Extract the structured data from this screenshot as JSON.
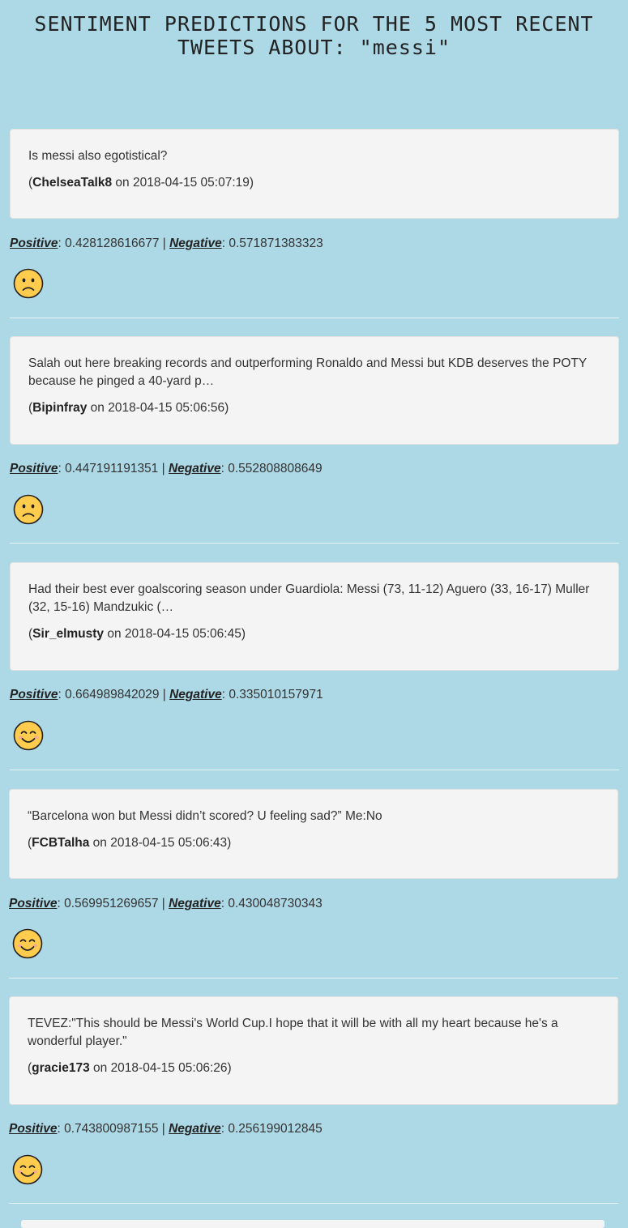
{
  "title": "SENTIMENT PREDICTIONS FOR THE 5 MOST RECENT TWEETS ABOUT: \"messi\"",
  "labels": {
    "positive": "Positive",
    "negative": "Negative"
  },
  "tweets": [
    {
      "text": "Is messi also egotistical?",
      "user": "ChelseaTalk8",
      "timestamp": "2018-04-15 05:07:19",
      "positive": "0.428128616677",
      "negative": "0.571871383323",
      "sentiment_icon": "sad-face-icon"
    },
    {
      "text": "Salah out here breaking records and outperforming Ronaldo and Messi but KDB deserves the POTY because he pinged a 40-yard p…",
      "user": "Bipinfray",
      "timestamp": "2018-04-15 05:06:56",
      "positive": "0.447191191351",
      "negative": "0.552808808649",
      "sentiment_icon": "sad-face-icon"
    },
    {
      "text": "Had their best ever goalscoring season under Guardiola: Messi (73, 11-12) Aguero (33, 16-17) Muller (32, 15-16) Mandzukic (…",
      "user": "Sir_elmusty",
      "timestamp": "2018-04-15 05:06:45",
      "positive": "0.664989842029",
      "negative": "0.335010157971",
      "sentiment_icon": "smiling-face-icon"
    },
    {
      "text": "“Barcelona won but Messi didn’t scored? U feeling sad?” Me:No",
      "user": "FCBTalha",
      "timestamp": "2018-04-15 05:06:43",
      "positive": "0.569951269657",
      "negative": "0.430048730343",
      "sentiment_icon": "smiling-face-icon"
    },
    {
      "text": "TEVEZ:\"This should be Messi's World Cup.I hope that it will be with all my heart because he's a wonderful player.\"",
      "user": "gracie173",
      "timestamp": "2018-04-15 05:06:26",
      "positive": "0.743800987155",
      "negative": "0.256199012845",
      "sentiment_icon": "smiling-face-icon"
    }
  ]
}
